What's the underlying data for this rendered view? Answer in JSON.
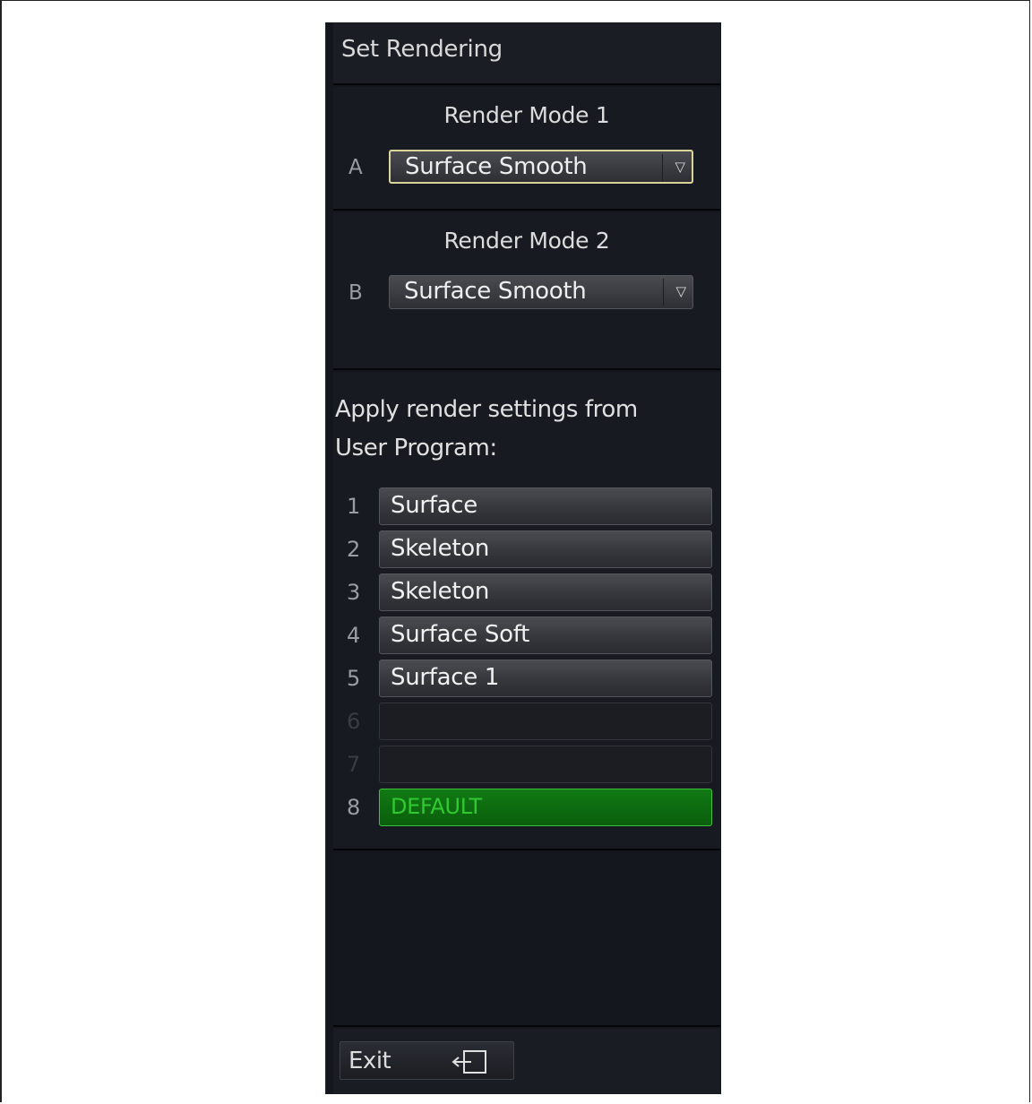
{
  "panel": {
    "title": "Set Rendering"
  },
  "render_mode_1": {
    "title": "Render Mode 1",
    "letter": "A",
    "selected": "Surface Smooth"
  },
  "render_mode_2": {
    "title": "Render Mode 2",
    "letter": "B",
    "selected": "Surface Smooth"
  },
  "user_program": {
    "heading_line1": "Apply render settings from",
    "heading_line2": "User Program:",
    "items": [
      {
        "number": "1",
        "label": "Surface"
      },
      {
        "number": "2",
        "label": "Skeleton"
      },
      {
        "number": "3",
        "label": "Skeleton"
      },
      {
        "number": "4",
        "label": "Surface Soft"
      },
      {
        "number": "5",
        "label": "Surface 1"
      },
      {
        "number": "6",
        "label": ""
      },
      {
        "number": "7",
        "label": ""
      },
      {
        "number": "8",
        "label": "DEFAULT"
      }
    ]
  },
  "footer": {
    "exit_label": "Exit",
    "exit_icon": "exit-door-icon"
  },
  "colors": {
    "panel_bg": "#14161d",
    "default_green": "#31c931",
    "active_outline": "#d8d49a"
  }
}
